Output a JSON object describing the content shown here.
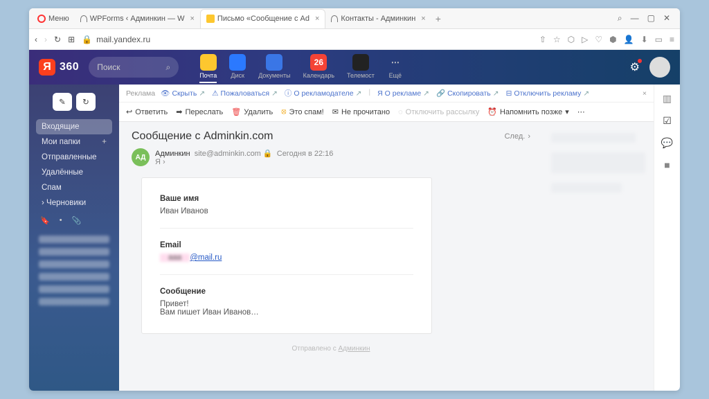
{
  "browser": {
    "menu": "Меню",
    "tabs": [
      {
        "label": "WPForms ‹ Админкин — W"
      },
      {
        "label": "Письмо «Сообщение с Ad",
        "active": true
      },
      {
        "label": "Контакты - Админкин"
      }
    ],
    "url": "mail.yandex.ru"
  },
  "header": {
    "brand": "360",
    "search_placeholder": "Поиск",
    "services": [
      {
        "name": "Почта",
        "color": "#fdc72f",
        "active": true
      },
      {
        "name": "Диск",
        "color": "#2b79ff"
      },
      {
        "name": "Документы",
        "color": "#3a76e6"
      },
      {
        "name": "Календарь",
        "color": "#f44336",
        "badge": "26"
      },
      {
        "name": "Телемост",
        "color": "#222"
      },
      {
        "name": "Ещё",
        "color": "transparent",
        "dots": true
      }
    ]
  },
  "sidebar": {
    "folders": [
      {
        "label": "Входящие",
        "active": true
      },
      {
        "label": "Мои папки",
        "plus": true
      },
      {
        "label": "Отправленные"
      },
      {
        "label": "Удалённые"
      },
      {
        "label": "Спам"
      },
      {
        "label": "Черновики",
        "caret": true
      }
    ]
  },
  "adbar": {
    "title": "Реклама",
    "items": [
      "Скрыть",
      "Пожаловаться",
      "О рекламодателе",
      "О рекламе",
      "Скопировать",
      "Отключить рекламу"
    ]
  },
  "toolbar": {
    "reply": "Ответить",
    "forward": "Переслать",
    "delete": "Удалить",
    "spam": "Это спам!",
    "unread": "Не прочитано",
    "unsub": "Отключить рассылку",
    "remind": "Напомнить позже"
  },
  "message": {
    "subject": "Сообщение с Adminkin.com",
    "next": "След.",
    "sender_initials": "АД",
    "sender_name": "Админкин",
    "sender_email": "site@adminkin.com",
    "date": "Сегодня в 22:16",
    "to": "Я",
    "fields": {
      "name_label": "Ваше имя",
      "name_value": "Иван Иванов",
      "email_label": "Email",
      "email_value": "@mail.ru",
      "msg_label": "Сообщение",
      "msg_value": "Привет!\nВам пишет Иван Иванов…"
    },
    "footer_prefix": "Отправлено с ",
    "footer_link": "Админкин"
  }
}
